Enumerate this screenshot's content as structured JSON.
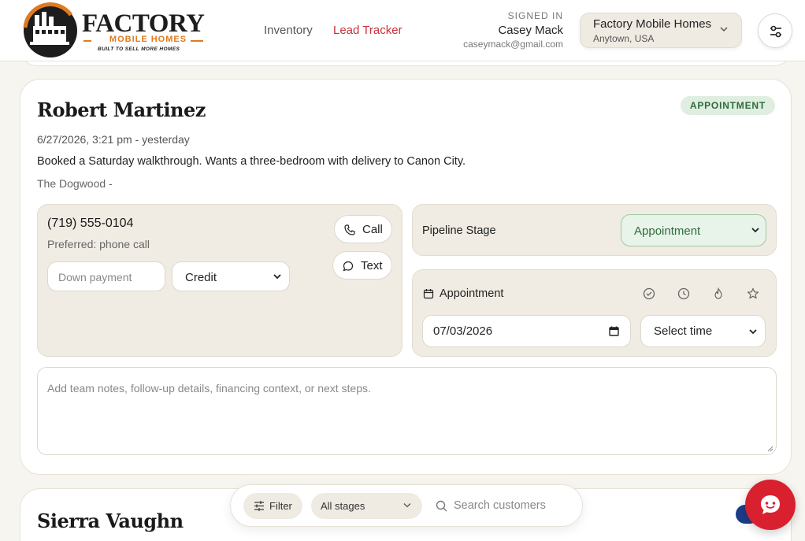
{
  "brand": {
    "name": "FACTORY",
    "sub": "MOBILE HOMES",
    "tagline": "BUILT TO SELL MORE HOMES",
    "accent": "#e07a1f"
  },
  "nav": {
    "items": [
      {
        "label": "Inventory",
        "active": false
      },
      {
        "label": "Lead Tracker",
        "active": true
      }
    ]
  },
  "user": {
    "signed_label": "SIGNED IN",
    "name": "Casey Mack",
    "email": "caseymack@gmail.com"
  },
  "dealer": {
    "name": "Factory Mobile Homes",
    "location": "Anytown, USA"
  },
  "lead": {
    "name": "Robert Martinez",
    "status": "APPOINTMENT",
    "date": "6/27/2026, 3:21 pm - yesterday",
    "note": "Booked a Saturday walkthrough. Wants a three-bedroom with delivery to Canon City.",
    "model": "The Dogwood -",
    "phone": "(719) 555-0104",
    "preferred": "Preferred: phone call",
    "call_label": "Call",
    "text_label": "Text",
    "down_payment_placeholder": "Down payment",
    "financing": "Credit",
    "pipeline_label": "Pipeline Stage",
    "pipeline_stage": "Appointment",
    "appointment_label": "Appointment",
    "appointment_date": "07/03/2026",
    "appointment_time": "Select time",
    "notes_placeholder": "Add team notes, follow-up details, financing context, or next steps."
  },
  "next_lead": {
    "name": "Sierra Vaughn"
  },
  "filter": {
    "filter_label": "Filter",
    "stage_value": "All stages",
    "search_placeholder": "Search customers"
  },
  "colors": {
    "primary_red": "#d9202e",
    "appointment_green": "#2f6b3c",
    "panel_bg": "#f0ece3"
  }
}
